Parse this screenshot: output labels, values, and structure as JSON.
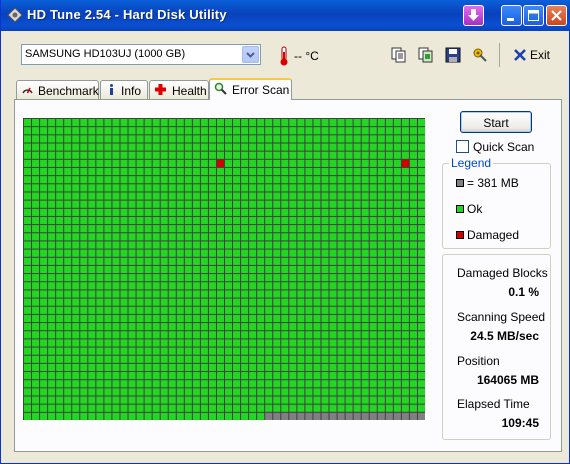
{
  "window": {
    "title": "HD Tune 2.54 - Hard Disk Utility"
  },
  "toolbar": {
    "drive": "SAMSUNG HD103UJ (1000 GB)",
    "temperature": "-- °C",
    "exit_label": "Exit",
    "icons": [
      "copy-text-icon",
      "copy-screenshot-icon",
      "save-icon",
      "options-icon"
    ]
  },
  "tabs": [
    {
      "label": "Benchmark",
      "icon": "benchmark-icon"
    },
    {
      "label": "Info",
      "icon": "info-icon"
    },
    {
      "label": "Health",
      "icon": "health-icon"
    },
    {
      "label": "Error Scan",
      "icon": "magnifier-icon",
      "active": true
    }
  ],
  "scan": {
    "start_label": "Start",
    "quick_scan_label": "Quick Scan",
    "quick_scan_checked": false,
    "grid": {
      "columns": 50,
      "rows": 37,
      "scanned_blocks": 1830,
      "damaged_blocks_positions": [
        [
          5,
          24
        ],
        [
          5,
          47
        ]
      ]
    }
  },
  "legend": {
    "title": "Legend",
    "items": [
      {
        "label": "= 381 MB",
        "color": "#808080"
      },
      {
        "label": "Ok",
        "color": "#22d622"
      },
      {
        "label": "Damaged",
        "color": "#d40000"
      }
    ]
  },
  "stats": {
    "damaged_blocks_label": "Damaged Blocks",
    "damaged_blocks_value": "0.1 %",
    "speed_label": "Scanning Speed",
    "speed_value": "24.5 MB/sec",
    "position_label": "Position",
    "position_value": "164065 MB",
    "elapsed_label": "Elapsed Time",
    "elapsed_value": "109:45"
  },
  "colors": {
    "titlebar": "#0842bb",
    "ok": "#22d622",
    "damaged": "#d40000",
    "unscanned": "#808080",
    "legend_title": "#0046d5"
  }
}
